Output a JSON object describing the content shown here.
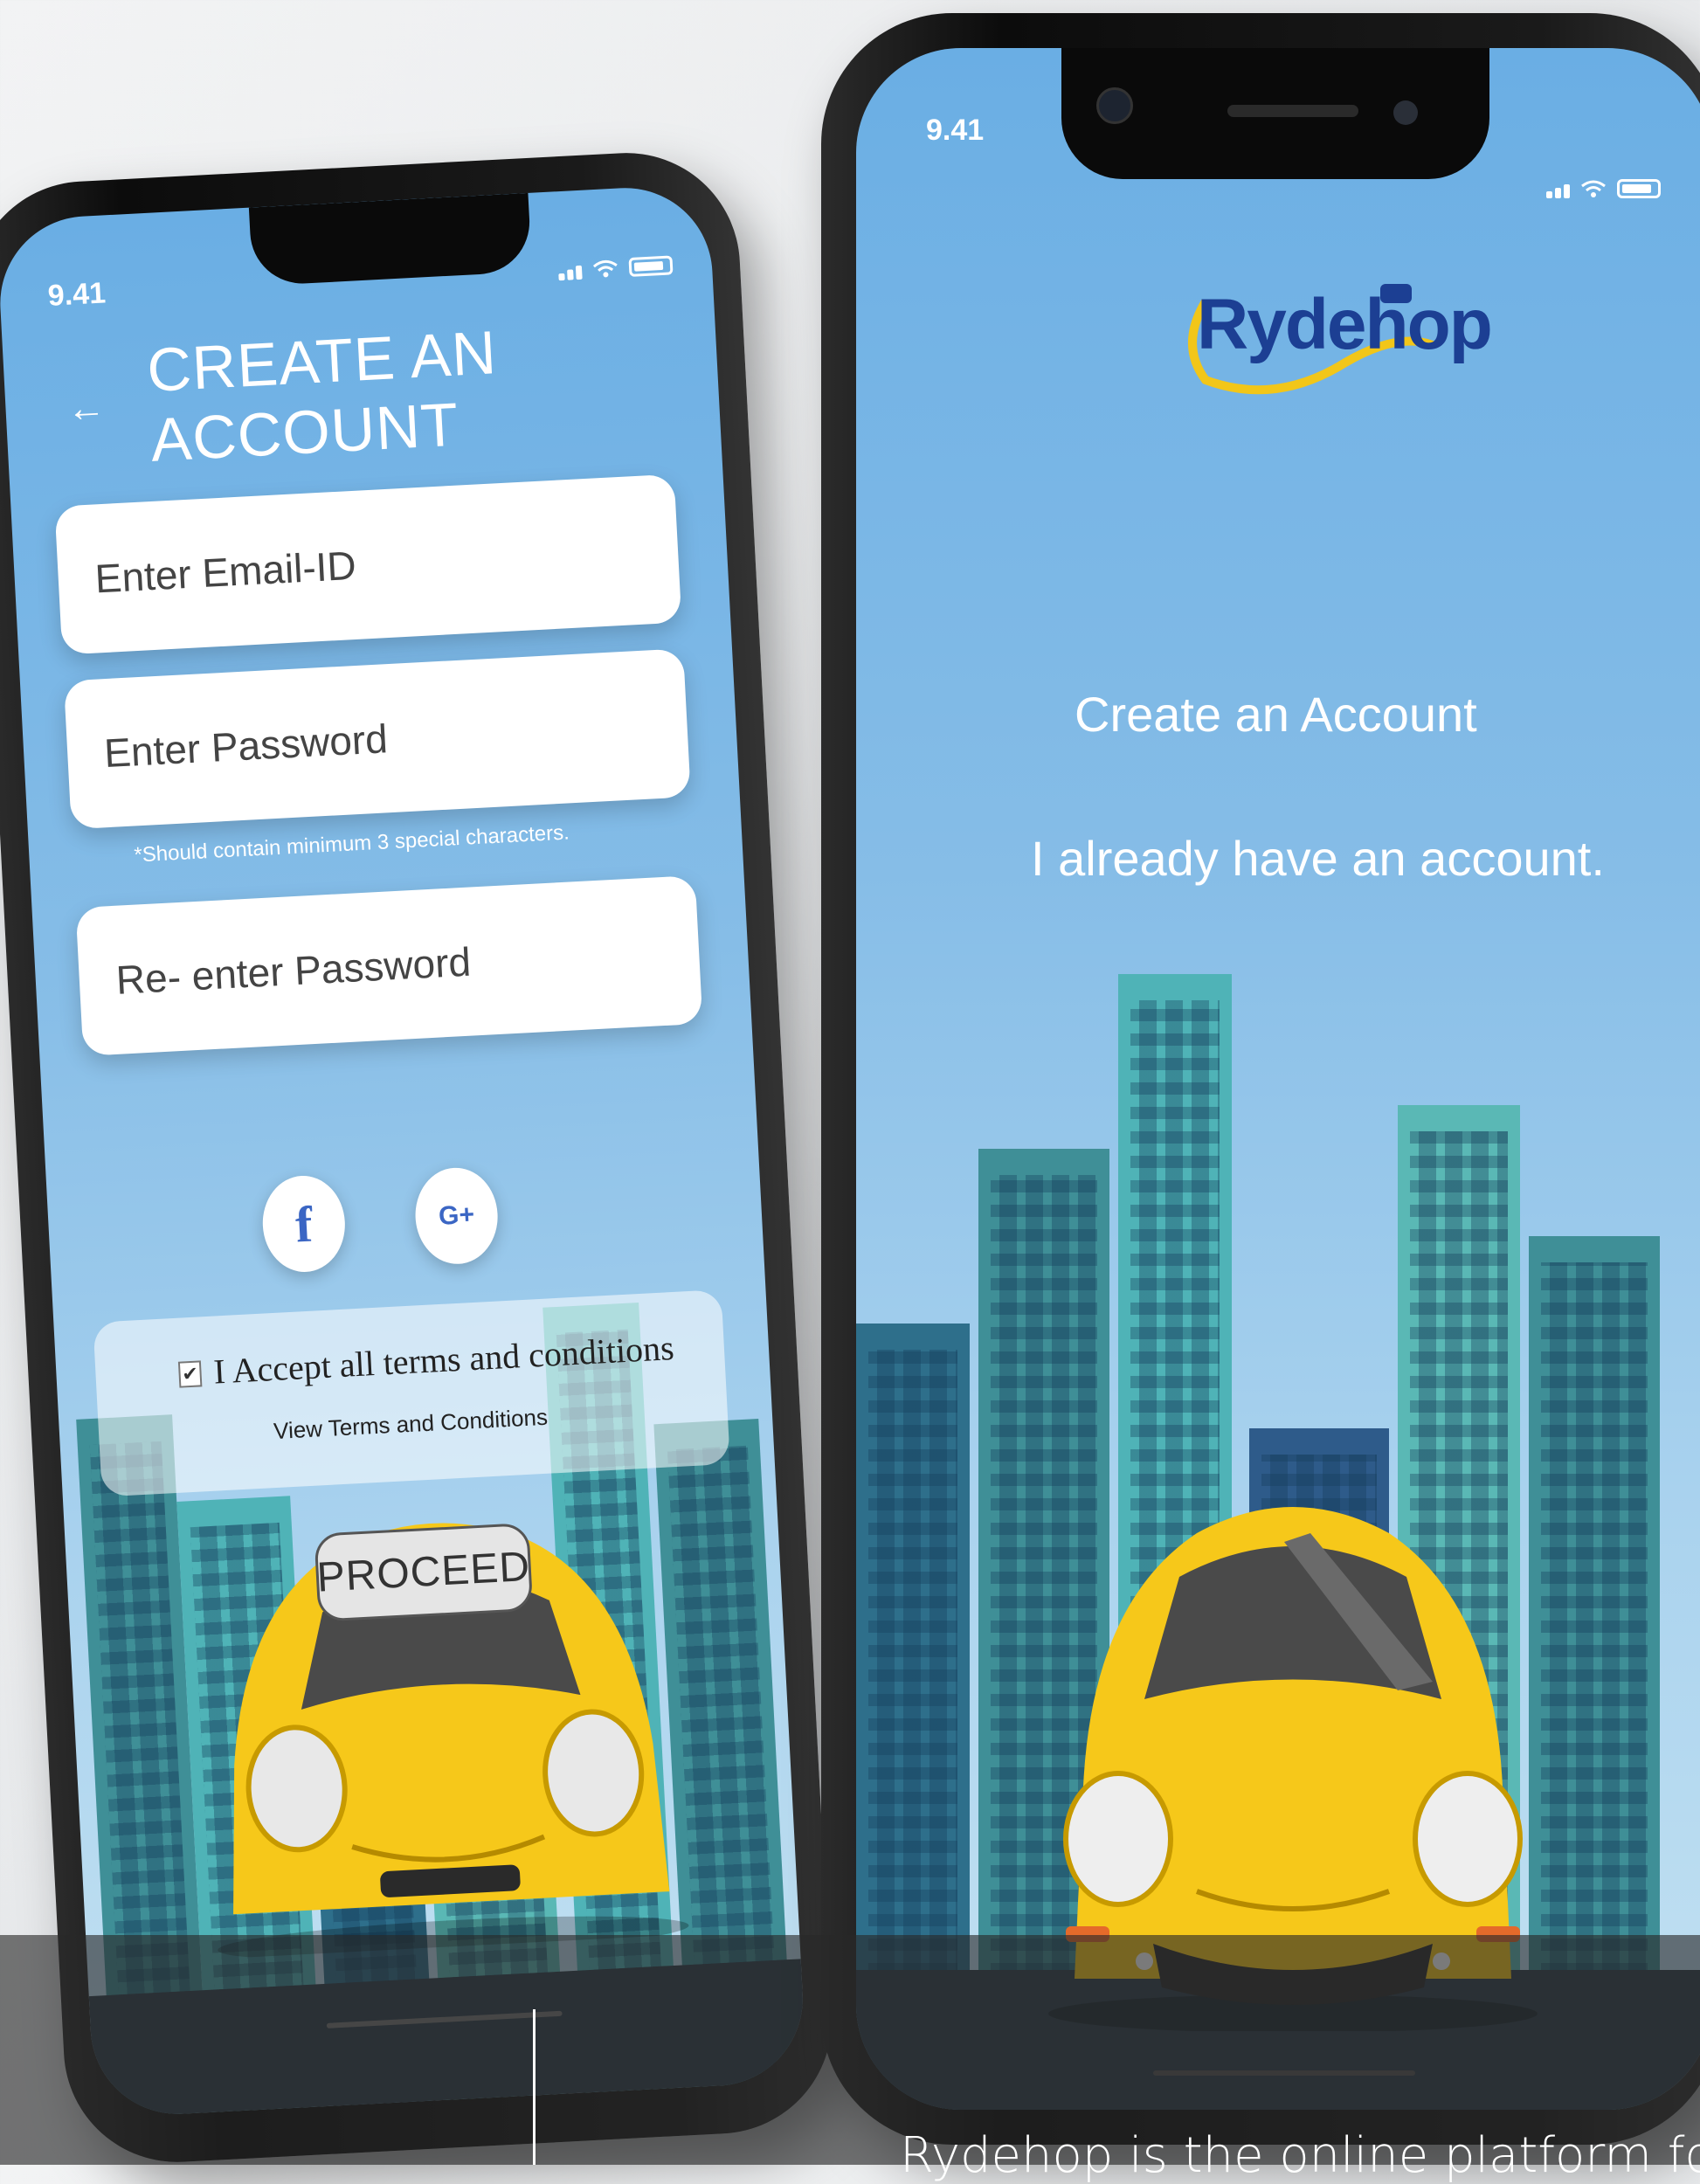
{
  "left_screen": {
    "status_time": "9.41",
    "title": "CREATE AN ACCOUNT",
    "back_icon": "back-arrow-icon",
    "fields": {
      "email_placeholder": "Enter Email-ID",
      "password_placeholder": "Enter Password",
      "password_hint": "*Should contain minimum 3 special characters.",
      "reenter_placeholder": "Re- enter Password"
    },
    "social": {
      "facebook_icon": "f",
      "google_icon": "G+"
    },
    "terms": {
      "checkbox_checked": true,
      "accept_label": "I Accept all terms and conditions",
      "view_link": "View Terms and Conditions"
    },
    "proceed_label": "PROCEED"
  },
  "right_screen": {
    "status_time": "9.41",
    "logo_text": "Rydehop",
    "create_account_link": "Create an Account",
    "login_link": "I already have an account."
  },
  "caption": "Rydehop is the online platform for",
  "colors": {
    "sky_blue": "#6aaee4",
    "car_yellow": "#f6c81a",
    "building_teal": "#4fb3b7",
    "logo_blue": "#1c3f93",
    "logo_yellow": "#f2c619"
  }
}
